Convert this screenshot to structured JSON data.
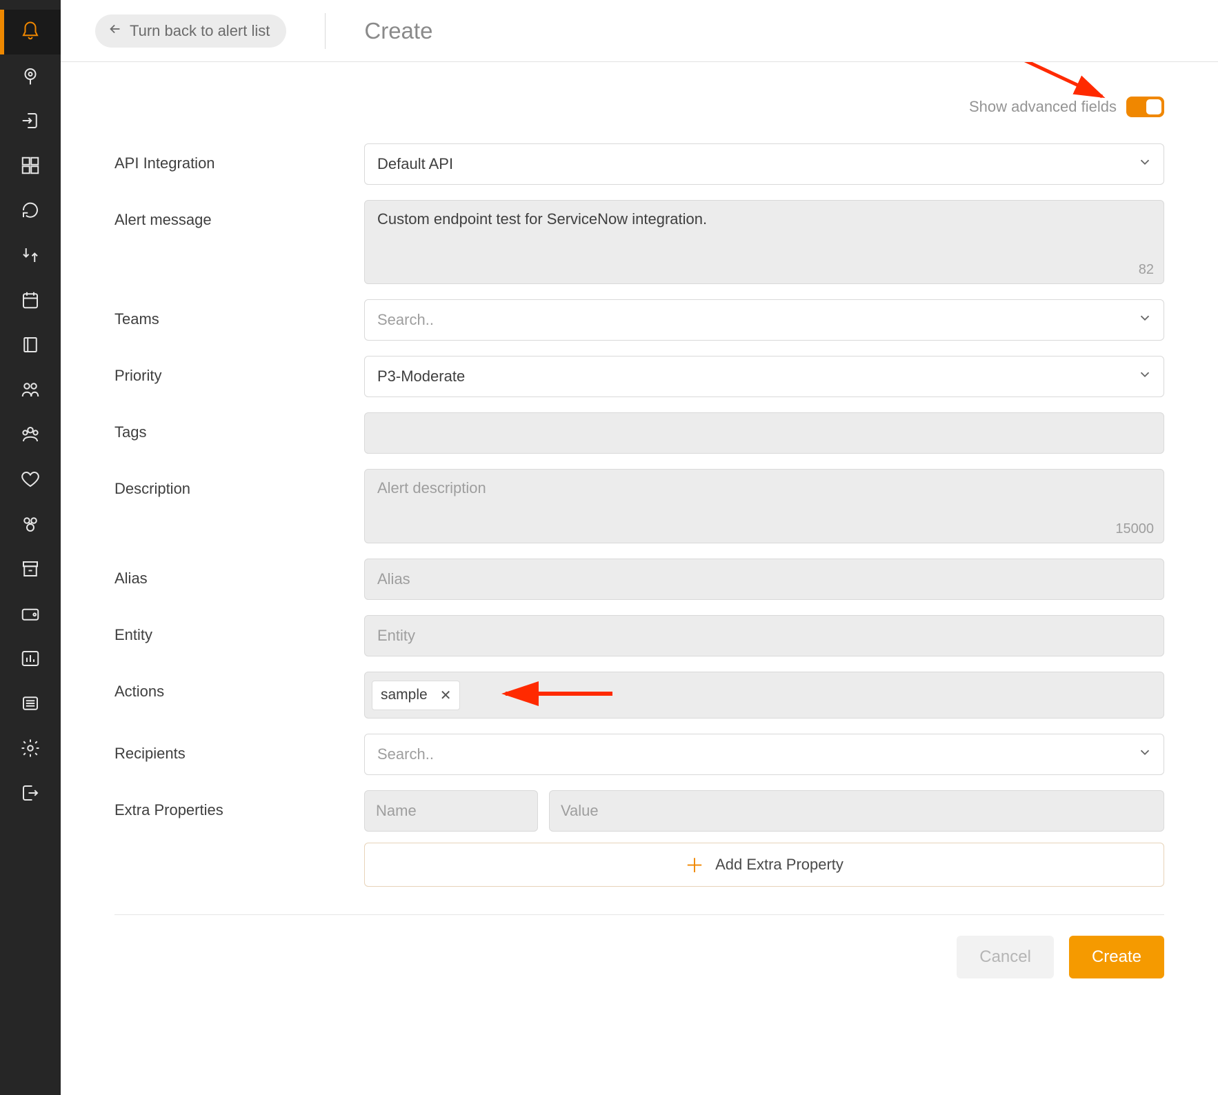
{
  "header": {
    "back_label": "Turn back to alert list",
    "page_title": "Create"
  },
  "advanced": {
    "label": "Show advanced fields",
    "on": true
  },
  "labels": {
    "api_integration": "API Integration",
    "alert_message": "Alert message",
    "teams": "Teams",
    "priority": "Priority",
    "tags": "Tags",
    "description": "Description",
    "alias": "Alias",
    "entity": "Entity",
    "actions": "Actions",
    "recipients": "Recipients",
    "extra_properties": "Extra Properties"
  },
  "values": {
    "api_integration": "Default API",
    "alert_message": "Custom endpoint test for ServiceNow integration.",
    "alert_message_counter": "82",
    "teams_placeholder": "Search..",
    "priority": "P3-Moderate",
    "description_placeholder": "Alert description",
    "description_counter": "15000",
    "alias_placeholder": "Alias",
    "entity_placeholder": "Entity",
    "actions_tag": "sample",
    "recipients_placeholder": "Search..",
    "extra_name_placeholder": "Name",
    "extra_value_placeholder": "Value",
    "add_extra_label": "Add Extra Property"
  },
  "footer": {
    "cancel": "Cancel",
    "create": "Create"
  },
  "sidebar_icons": [
    "bell-icon",
    "location-pin-icon",
    "login-icon",
    "grid-icon",
    "loop-icon",
    "transfer-icon",
    "calendar-icon",
    "book-icon",
    "people-icon",
    "group-icon",
    "heart-icon",
    "bug-icon",
    "archive-icon",
    "wallet-icon",
    "chart-icon",
    "list-icon",
    "gear-icon",
    "logout-icon"
  ]
}
